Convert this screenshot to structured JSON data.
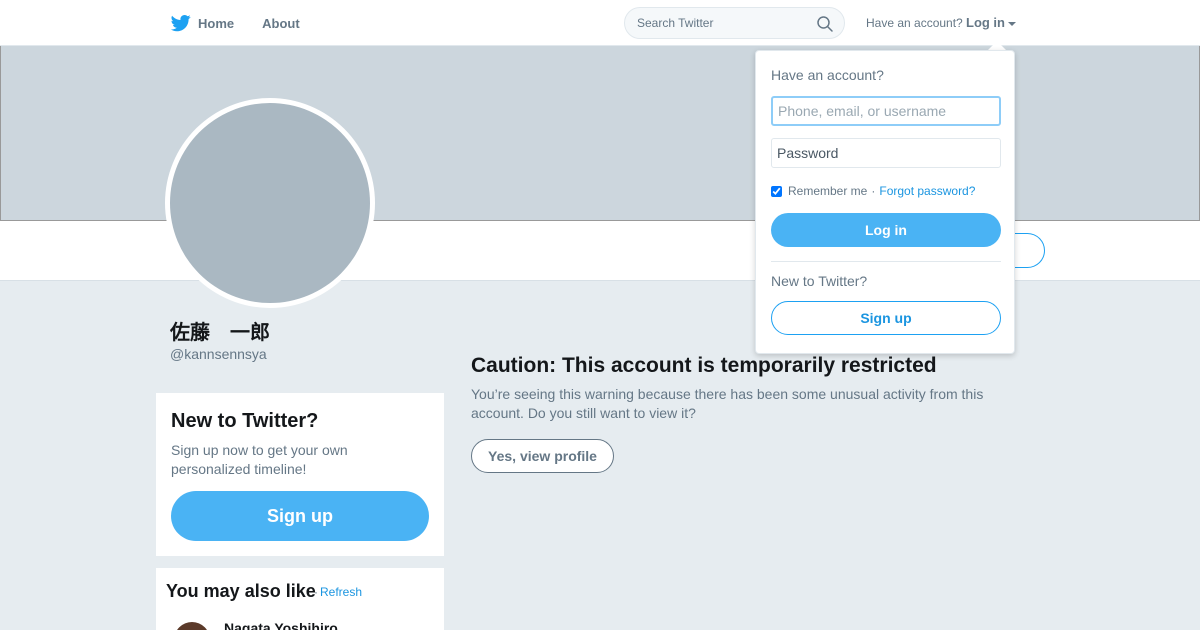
{
  "nav": {
    "home_label": "Home",
    "about_label": "About",
    "logo_icon": "twitter-bird-icon",
    "accent": "#1da1f2"
  },
  "search": {
    "placeholder": "Search Twitter",
    "icon": "search-icon"
  },
  "account": {
    "prompt": "Have an account?",
    "login_label": "Log in"
  },
  "profile": {
    "display_name": "佐藤　一郎",
    "handle": "@kannsennsya"
  },
  "signup_card": {
    "title": "New to Twitter?",
    "subtitle": "Sign up now to get your own personalized timeline!",
    "button": "Sign up"
  },
  "suggestions": {
    "title": "You may also like",
    "separator": "·",
    "refresh": "Refresh",
    "items": [
      {
        "name": "Nagata Yoshihiro"
      }
    ]
  },
  "caution": {
    "title": "Caution: This account is temporarily restricted",
    "body": "You’re seeing this warning because there has been some unusual activity from this account. Do you still want to view it?",
    "button": "Yes, view profile"
  },
  "login_dropdown": {
    "heading": "Have an account?",
    "username_placeholder": "Phone, email, or username",
    "password_placeholder": "Password",
    "remember_label": "Remember me",
    "separator": "·",
    "forgot_label": "Forgot password?",
    "remember_checked": true,
    "login_button": "Log in",
    "new_prompt": "New to Twitter?",
    "signup_button": "Sign up"
  }
}
